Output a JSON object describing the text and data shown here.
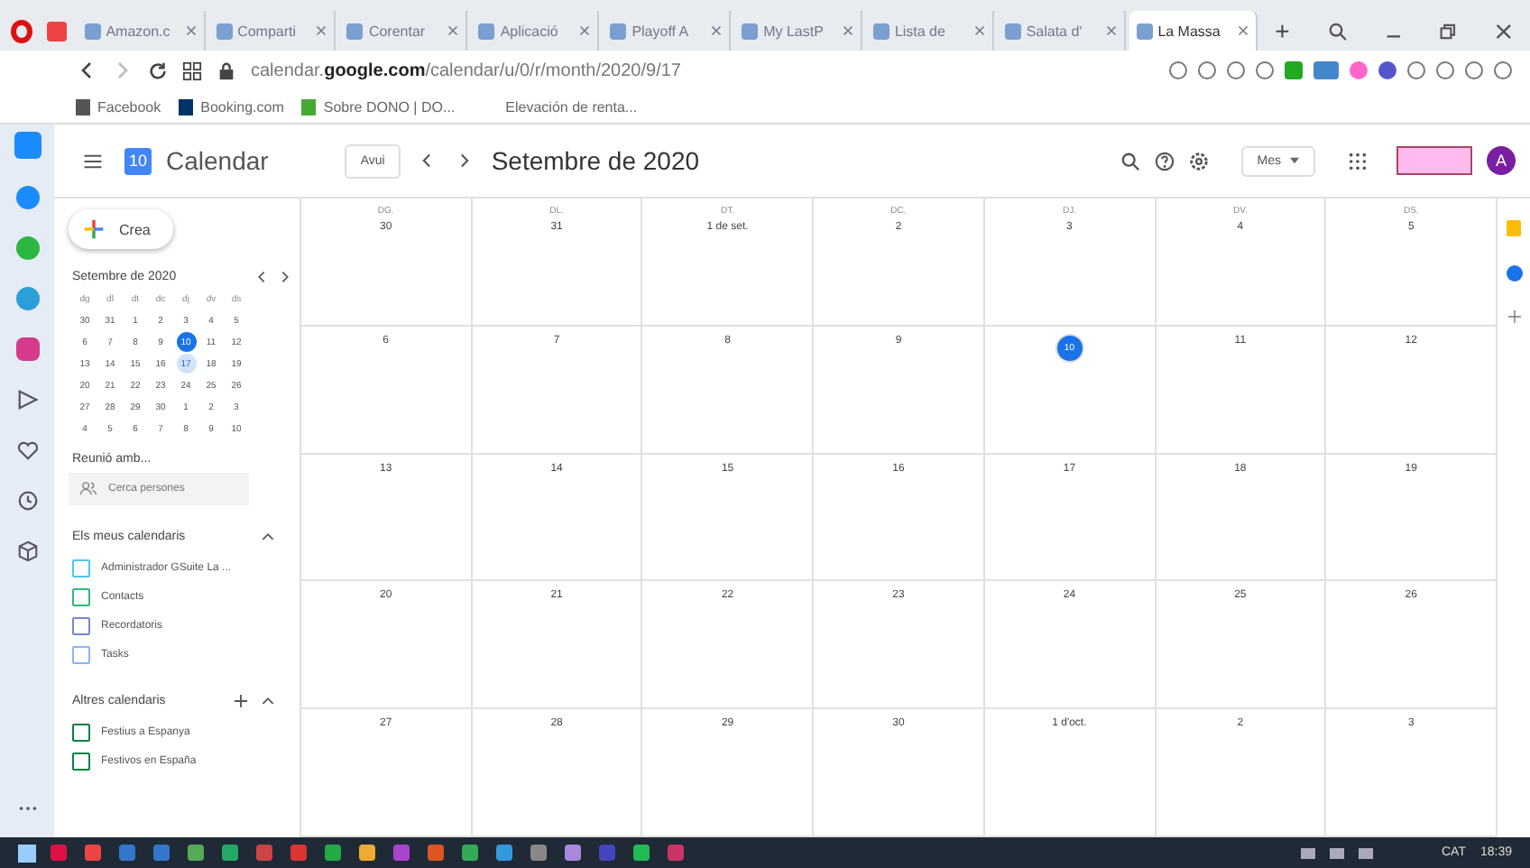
{
  "browser": {
    "tabs": [
      {
        "label": "Amazon.c",
        "selected": false
      },
      {
        "label": "Comparti",
        "selected": false
      },
      {
        "label": "Corentar",
        "selected": false
      },
      {
        "label": "Aplicació",
        "selected": false
      },
      {
        "label": "Playoff A",
        "selected": false
      },
      {
        "label": "My LastP",
        "selected": false
      },
      {
        "label": "Lista de",
        "selected": false
      },
      {
        "label": "Salata d'",
        "selected": false
      },
      {
        "label": "La Massa",
        "selected": true
      }
    ],
    "new_tab": "+",
    "address": "calendar.**google.com**/calendar/u/0/r/month/2020/9/17",
    "bookmarks": [
      "Facebook",
      "Booking.com",
      "Sobre DONO | DO...",
      "Elevación de renta..."
    ]
  },
  "calendar": {
    "logo_day": "10",
    "app_name": "Calendar",
    "today_button": "Avui",
    "period": "Setembre de 2020",
    "view": "Mes",
    "avatar": "A",
    "create": "Crea",
    "mini_calendar": {
      "title": "Setembre de 2020",
      "weekdays": [
        "dg",
        "dl",
        "dt",
        "dc",
        "dj",
        "dv",
        "ds"
      ],
      "weeks": [
        [
          {
            "day": "30",
            "today": false,
            "selected": false
          },
          {
            "day": "31",
            "today": false,
            "selected": false
          },
          {
            "day": "1",
            "today": false,
            "selected": false
          },
          {
            "day": "2",
            "today": false,
            "selected": false
          },
          {
            "day": "3",
            "today": false,
            "selected": false
          },
          {
            "day": "4",
            "today": false,
            "selected": false
          },
          {
            "day": "5",
            "today": false,
            "selected": false
          }
        ],
        [
          {
            "day": "6",
            "today": false,
            "selected": false
          },
          {
            "day": "7",
            "today": false,
            "selected": false
          },
          {
            "day": "8",
            "today": false,
            "selected": false
          },
          {
            "day": "9",
            "today": false,
            "selected": false
          },
          {
            "day": "10",
            "today": true,
            "selected": false
          },
          {
            "day": "11",
            "today": false,
            "selected": false
          },
          {
            "day": "12",
            "today": false,
            "selected": false
          }
        ],
        [
          {
            "day": "13",
            "today": false,
            "selected": false
          },
          {
            "day": "14",
            "today": false,
            "selected": false
          },
          {
            "day": "15",
            "today": false,
            "selected": false
          },
          {
            "day": "16",
            "today": false,
            "selected": false
          },
          {
            "day": "17",
            "today": false,
            "selected": true
          },
          {
            "day": "18",
            "today": false,
            "selected": false
          },
          {
            "day": "19",
            "today": false,
            "selected": false
          }
        ],
        [
          {
            "day": "20",
            "today": false,
            "selected": false
          },
          {
            "day": "21",
            "today": false,
            "selected": false
          },
          {
            "day": "22",
            "today": false,
            "selected": false
          },
          {
            "day": "23",
            "today": false,
            "selected": false
          },
          {
            "day": "24",
            "today": false,
            "selected": false
          },
          {
            "day": "25",
            "today": false,
            "selected": false
          },
          {
            "day": "26",
            "today": false,
            "selected": false
          }
        ],
        [
          {
            "day": "27",
            "today": false,
            "selected": false
          },
          {
            "day": "28",
            "today": false,
            "selected": false
          },
          {
            "day": "29",
            "today": false,
            "selected": false
          },
          {
            "day": "30",
            "today": false,
            "selected": false
          },
          {
            "day": "1",
            "today": false,
            "selected": false
          },
          {
            "day": "2",
            "today": false,
            "selected": false
          },
          {
            "day": "3",
            "today": false,
            "selected": false
          }
        ],
        [
          {
            "day": "4",
            "today": false,
            "selected": false
          },
          {
            "day": "5",
            "today": false,
            "selected": false
          },
          {
            "day": "6",
            "today": false,
            "selected": false
          },
          {
            "day": "7",
            "today": false,
            "selected": false
          },
          {
            "day": "8",
            "today": false,
            "selected": false
          },
          {
            "day": "9",
            "today": false,
            "selected": false
          },
          {
            "day": "10",
            "today": false,
            "selected": false
          }
        ]
      ]
    },
    "meet": {
      "title": "Reunió amb...",
      "placeholder": "Cerca persones"
    },
    "my_calendars": {
      "title": "Els meus calendaris",
      "items": [
        {
          "label": "Administrador GSuite La ...",
          "color": "#4fc3f7",
          "checked": false
        },
        {
          "label": "Contacts",
          "color": "#33b679",
          "checked": false
        },
        {
          "label": "Recordatoris",
          "color": "#7986cb",
          "checked": false
        },
        {
          "label": "Tasks",
          "color": "#8ab4f8",
          "checked": false
        }
      ]
    },
    "other_calendars": {
      "title": "Altres calendaris",
      "items": [
        {
          "label": "Festius a Espanya",
          "color": "#0b8043",
          "checked": false
        },
        {
          "label": "Festivos en España",
          "color": "#0b8043",
          "checked": false
        }
      ]
    },
    "weekdays": [
      "DG.",
      "DL.",
      "DT.",
      "DC.",
      "DJ.",
      "DV.",
      "DS."
    ],
    "weeks": [
      [
        {
          "label": "30",
          "today": false
        },
        {
          "label": "31",
          "today": false
        },
        {
          "label": "1 de set.",
          "today": false
        },
        {
          "label": "2",
          "today": false
        },
        {
          "label": "3",
          "today": false
        },
        {
          "label": "4",
          "today": false
        },
        {
          "label": "5",
          "today": false
        }
      ],
      [
        {
          "label": "6",
          "today": false
        },
        {
          "label": "7",
          "today": false
        },
        {
          "label": "8",
          "today": false
        },
        {
          "label": "9",
          "today": false
        },
        {
          "label": "10",
          "today": true
        },
        {
          "label": "11",
          "today": false
        },
        {
          "label": "12",
          "today": false
        }
      ],
      [
        {
          "label": "13",
          "today": false
        },
        {
          "label": "14",
          "today": false
        },
        {
          "label": "15",
          "today": false
        },
        {
          "label": "16",
          "today": false
        },
        {
          "label": "17",
          "today": false
        },
        {
          "label": "18",
          "today": false
        },
        {
          "label": "19",
          "today": false
        }
      ],
      [
        {
          "label": "20",
          "today": false
        },
        {
          "label": "21",
          "today": false
        },
        {
          "label": "22",
          "today": false
        },
        {
          "label": "23",
          "today": false
        },
        {
          "label": "24",
          "today": false
        },
        {
          "label": "25",
          "today": false
        },
        {
          "label": "26",
          "today": false
        }
      ],
      [
        {
          "label": "27",
          "today": false
        },
        {
          "label": "28",
          "today": false
        },
        {
          "label": "29",
          "today": false
        },
        {
          "label": "30",
          "today": false
        },
        {
          "label": "1 d'oct.",
          "today": false
        },
        {
          "label": "2",
          "today": false
        },
        {
          "label": "3",
          "today": false
        }
      ]
    ]
  },
  "taskbar": {
    "language": "CAT",
    "time": "18:39"
  }
}
